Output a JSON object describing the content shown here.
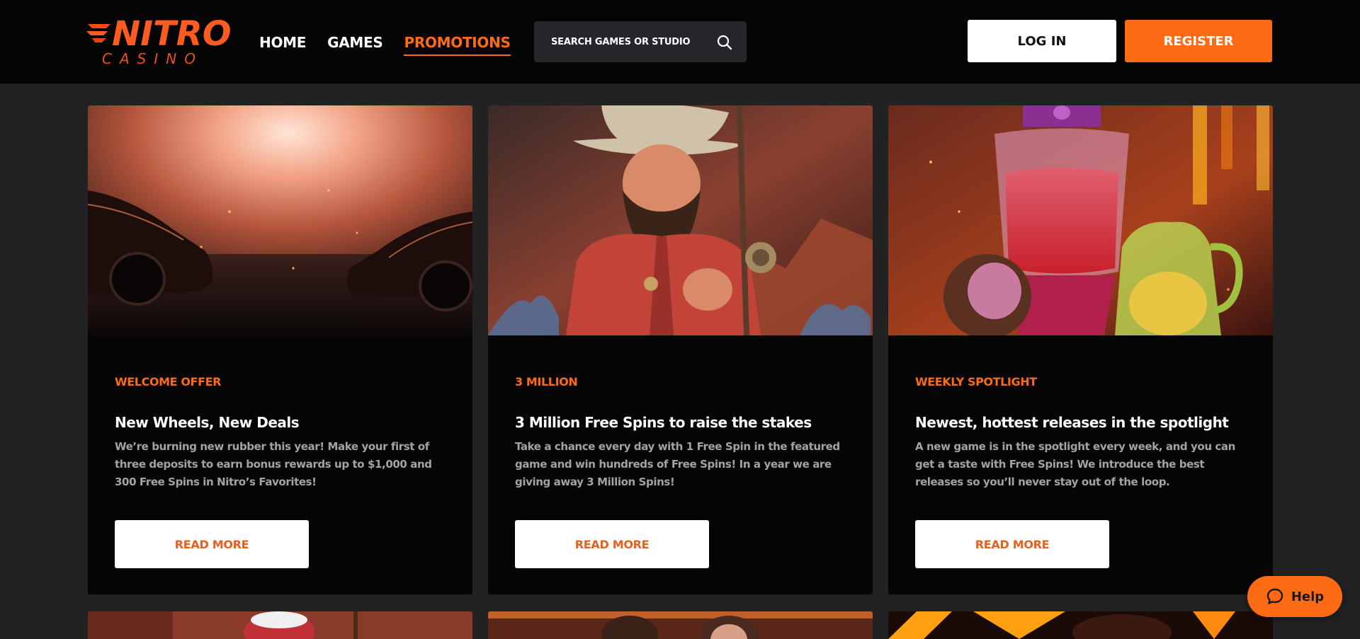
{
  "header": {
    "logo": {
      "brand": "NITRO",
      "sub": "CASINO"
    },
    "nav": [
      {
        "label": "HOME",
        "active": false
      },
      {
        "label": "GAMES",
        "active": false
      },
      {
        "label": "PROMOTIONS",
        "active": true
      }
    ],
    "search": {
      "placeholder": "SEARCH GAMES OR STUDIO",
      "icon": "search-icon"
    },
    "login_label": "LOG IN",
    "register_label": "REGISTER"
  },
  "promotions": [
    {
      "category": "WELCOME OFFER",
      "title": "New Wheels, New Deals",
      "description": "We’re burning new rubber this year! Make your first of three deposits to earn bonus rewards up to $1,000 and 300 Free Spins in Nitro’s Favorites!",
      "button_label": "READ MORE"
    },
    {
      "category": "3 MILLION",
      "title": "3 Million Free Spins to raise the stakes",
      "description": "Take a chance every day with 1 Free Spin in the featured game and win hundreds of Free Spins! In a year we are giving away 3 Million Spins!",
      "button_label": "READ MORE"
    },
    {
      "category": "WEEKLY SPOTLIGHT",
      "title": "Newest, hottest releases in the spotlight",
      "description": "A new game is in the spotlight every week, and you can get a taste with Free Spins! We introduce the best releases so you’ll never stay out of the loop.",
      "button_label": "READ MORE"
    }
  ],
  "help": {
    "label": "Help",
    "icon": "chat-bubble-icon"
  },
  "colors": {
    "accent": "#ff6a14",
    "page_background": "#222222",
    "header_background": "#050505",
    "card_background": "#050505",
    "body_text": "#a3a3a3"
  }
}
